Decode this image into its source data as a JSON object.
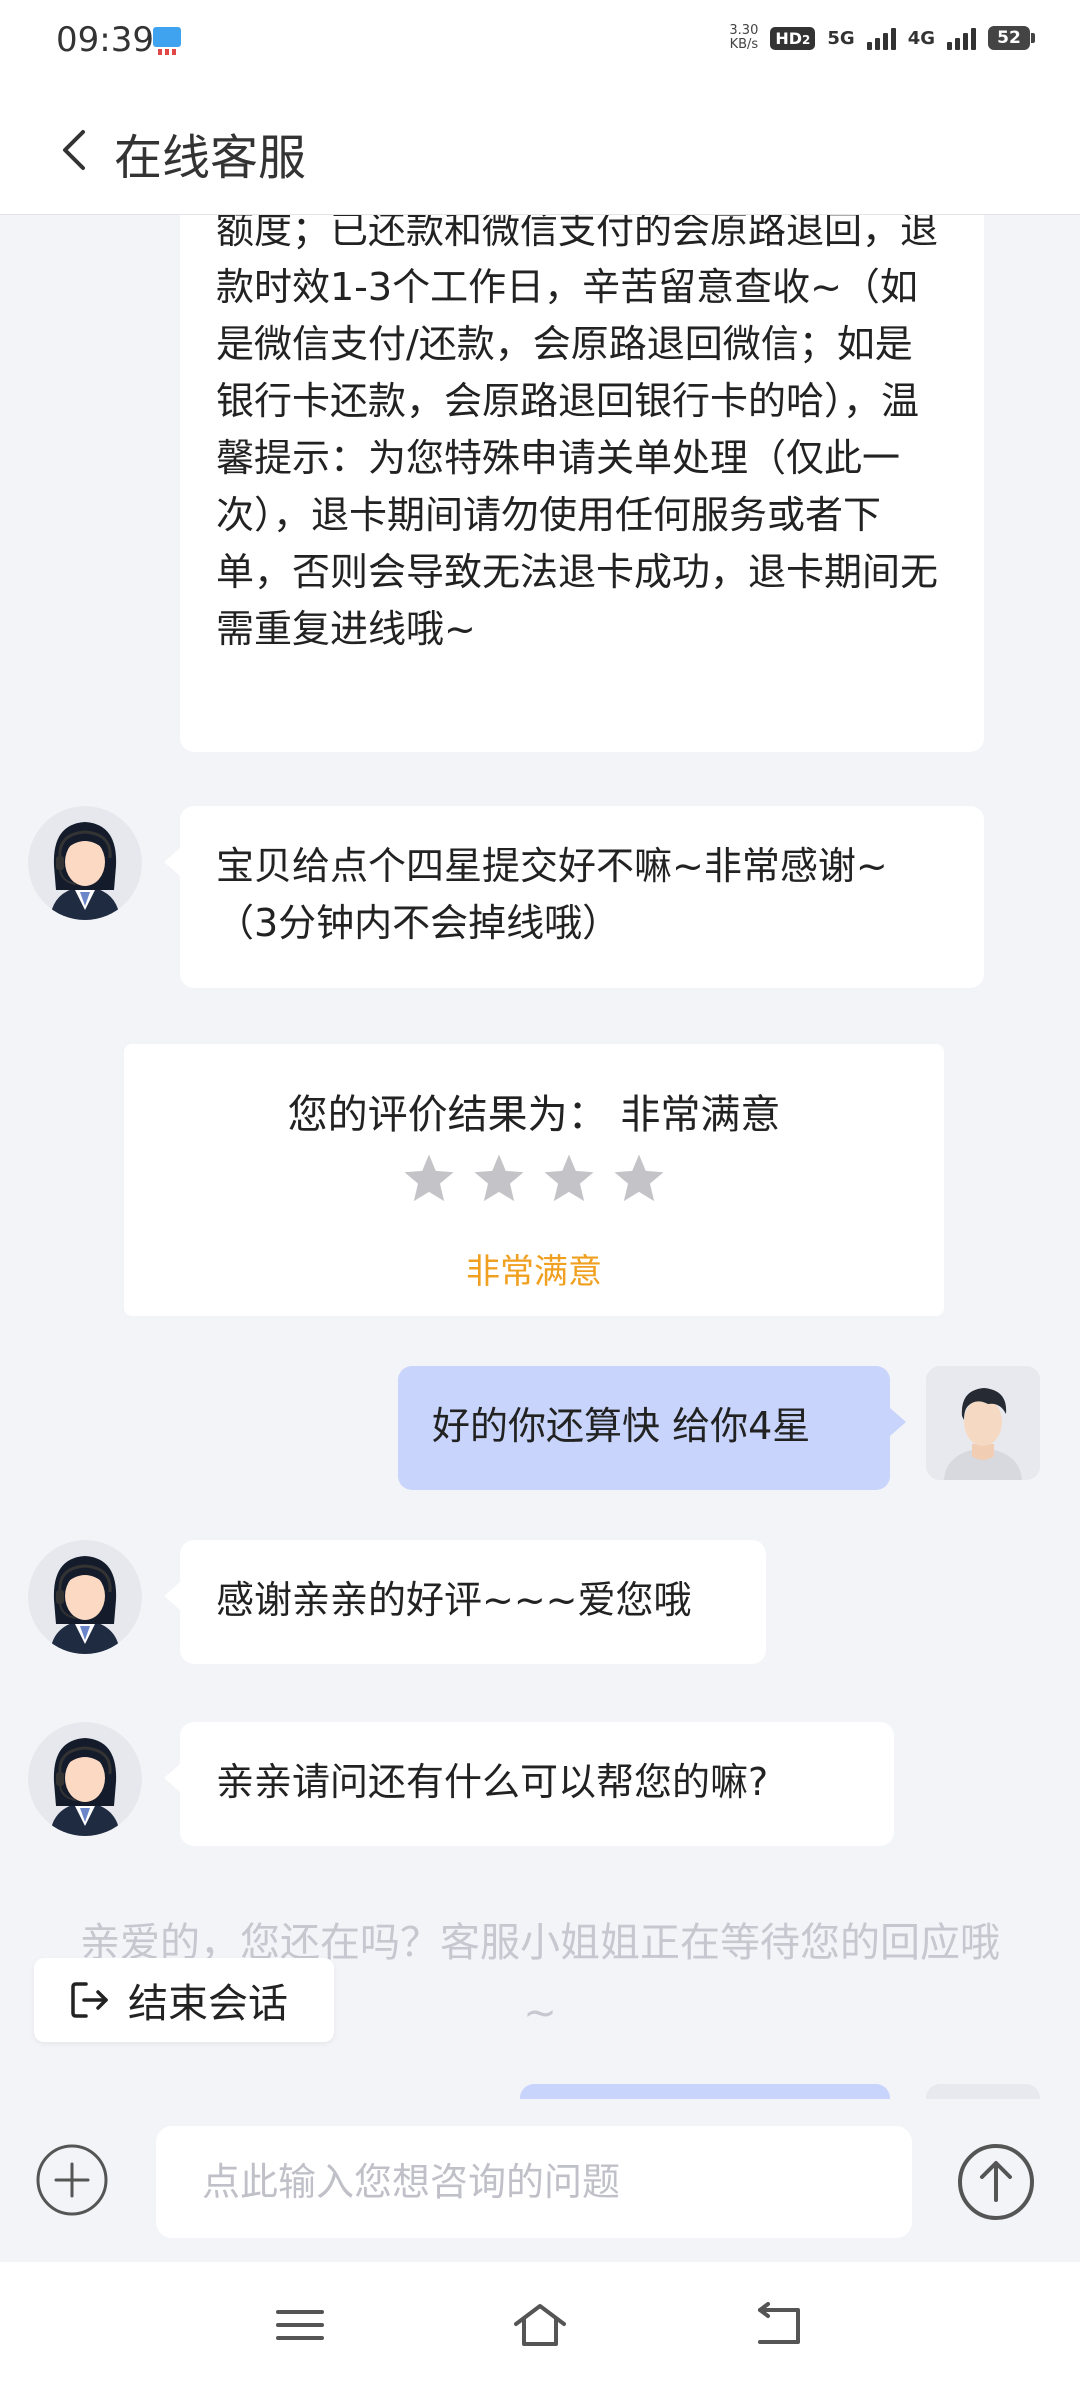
{
  "status_bar": {
    "time": "09:39",
    "net_speed_value": "3.30",
    "net_speed_unit": "KB/s",
    "hd_label": "HD",
    "hd_sub": "2",
    "sim1_label": "5G",
    "sim2_label": "4G",
    "battery": "52"
  },
  "header": {
    "title": "在线客服"
  },
  "messages": [
    {
      "sender": "agent",
      "text": "额度；已还款和微信支付的会原路退回，退款时效1-3个工作日，辛苦留意查收~（如是微信支付/还款，会原路退回微信；如是银行卡还款，会原路退回银行卡的哈），温馨提示：为您特殊申请关单处理（仅此一次），退卡期间请勿使用任何服务或者下单，否则会导致无法退卡成功，退卡期间无需重复进线哦~"
    },
    {
      "sender": "agent",
      "text": "宝贝给点个四星提交好不嘛~非常感谢~（3分钟内不会掉线哦）"
    },
    {
      "sender": "user",
      "text": "好的你还算快 给你4星"
    },
    {
      "sender": "agent",
      "text": "感谢亲亲的好评~~~爱您哦"
    },
    {
      "sender": "agent",
      "text": "亲亲请问还有什么可以帮您的嘛?"
    }
  ],
  "evaluation": {
    "title": "您的评价结果为： 非常满意",
    "stars": 4,
    "result_label": "非常满意",
    "result_color": "#f0a020",
    "star_color": "#c4c4c8"
  },
  "waiting_notice": "亲爱的，您还在吗？客服小姐姐正在等待您的回应哦~",
  "end_session": {
    "label": "结束会话",
    "icon": "exit-icon"
  },
  "input": {
    "placeholder": "点此输入您想咨询的问题"
  },
  "colors": {
    "user_bubble": "#c8d4fb",
    "background": "#f3f4f8"
  }
}
